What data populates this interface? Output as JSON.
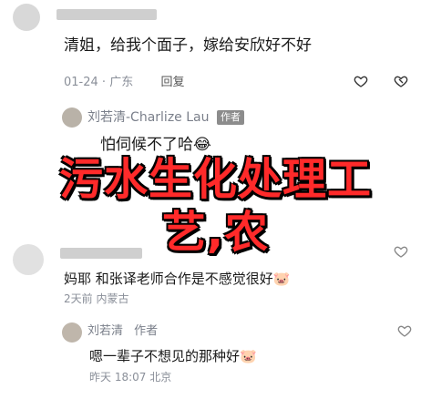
{
  "comments": [
    {
      "text": "清姐，给我个面子，嫁给安欣好不好",
      "date": "01-24",
      "location": "广东",
      "reply_label": "回复"
    },
    {
      "author": "刘若清-Charlize Lau",
      "author_tag": "作者",
      "text": "怕伺候不了哈",
      "emoji": "😂"
    },
    {
      "text": "妈耶 和张译老师合作是不感觉很好",
      "emoji": "🐷",
      "date": "2天前",
      "location": "内蒙古"
    },
    {
      "author": "刘若清",
      "author_tag": "作者",
      "text": "嗯一辈子不想见的那种好",
      "emoji": "🐷",
      "date": "昨天 18:07",
      "location": "北京"
    }
  ],
  "overlay": {
    "line1": "污水生化处理工",
    "line2": "艺,农"
  },
  "colors": {
    "overlay_text": "#ff2a2a",
    "overlay_outline": "#000000",
    "meta": "#8a8f99"
  }
}
